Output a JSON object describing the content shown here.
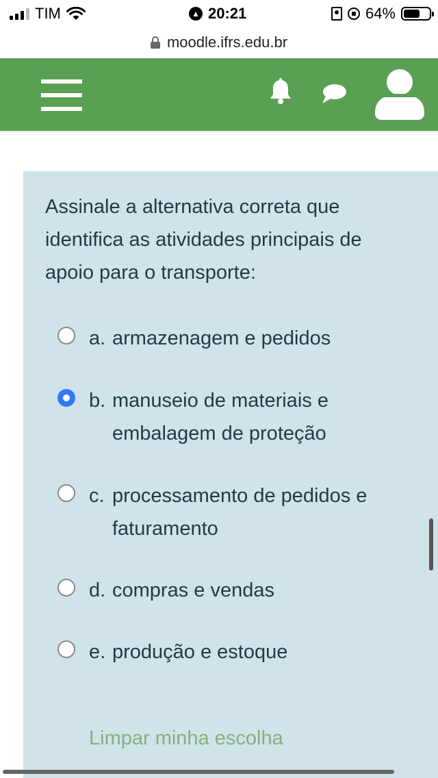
{
  "status_bar": {
    "carrier": "TIM",
    "time": "20:21",
    "battery_percent": "64%",
    "battery_level": 0.64
  },
  "url_bar": {
    "domain": "moodle.ifrs.edu.br"
  },
  "header": {
    "menu_icon": "hamburger-icon",
    "notifications_icon": "bell-icon",
    "messages_icon": "chat-bubble-icon",
    "user_icon": "user-avatar-icon",
    "background_color": "#5aa054"
  },
  "question": {
    "text": "Assinale a alternativa correta que identifica as atividades principais de apoio para o transporte:",
    "options": [
      {
        "letter": "a.",
        "text": "armazenagem e pedidos",
        "selected": false
      },
      {
        "letter": "b.",
        "text": "manuseio de materiais e embalagem de proteção",
        "selected": true
      },
      {
        "letter": "c.",
        "text": "processamento de pedidos e faturamento",
        "selected": false
      },
      {
        "letter": "d.",
        "text": "compras e vendas",
        "selected": false
      },
      {
        "letter": "e.",
        "text": "produção e estoque",
        "selected": false
      }
    ],
    "clear_label": "Limpar minha escolha"
  },
  "colors": {
    "card_background": "#d0e3e8",
    "selected_radio": "#2f7bf6",
    "link_color": "#86b07d"
  }
}
